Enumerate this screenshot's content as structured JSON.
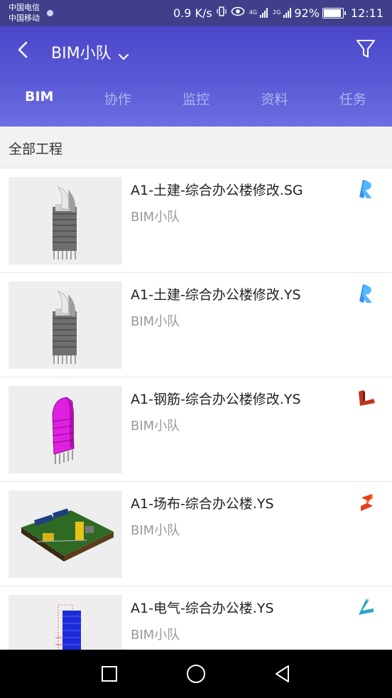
{
  "status_bar": {
    "carrier_1": "中国电信",
    "carrier_2": "中国移动",
    "speed": "0.9 K/s",
    "net_4g": "4G",
    "net_2g": "2G",
    "battery": "92%",
    "battery_level": 0.92,
    "time": "12:11",
    "icons": [
      "vibrate-icon",
      "eye-comfort-icon",
      "signal-icon",
      "battery-icon"
    ]
  },
  "header": {
    "title": "BIM小队",
    "back_icon": "back-arrow-icon",
    "dropdown_icon": "chevron-down-icon",
    "filter_icon": "filter-icon",
    "accent": "#4a47c9"
  },
  "tabs": [
    {
      "label": "BIM",
      "active": true
    },
    {
      "label": "协作",
      "active": false
    },
    {
      "label": "监控",
      "active": false
    },
    {
      "label": "资料",
      "active": false
    },
    {
      "label": "任务",
      "active": false
    }
  ],
  "section": {
    "title": "全部工程"
  },
  "projects": [
    {
      "name": "A1-土建-综合办公楼修改.SG",
      "team": "BIM小队",
      "app_icon": "revit-icon",
      "app_color": "#3d8cf5"
    },
    {
      "name": "A1-土建-综合办公楼修改.YS",
      "team": "BIM小队",
      "app_icon": "revit-icon",
      "app_color": "#3d8cf5"
    },
    {
      "name": "A1-钢筋-综合办公楼修改.YS",
      "team": "BIM小队",
      "app_icon": "rebar-icon",
      "app_color": "#c0341d"
    },
    {
      "name": "A1-场布-综合办公楼.YS",
      "team": "BIM小队",
      "app_icon": "site-layout-icon",
      "app_color": "#e8401c"
    },
    {
      "name": "A1-电气-综合办公楼.YS",
      "team": "BIM小队",
      "app_icon": "electrical-icon",
      "app_color": "#2aa6c9"
    }
  ],
  "nav_bar": {
    "icons": [
      "recent-apps-icon",
      "home-icon",
      "back-icon"
    ]
  }
}
